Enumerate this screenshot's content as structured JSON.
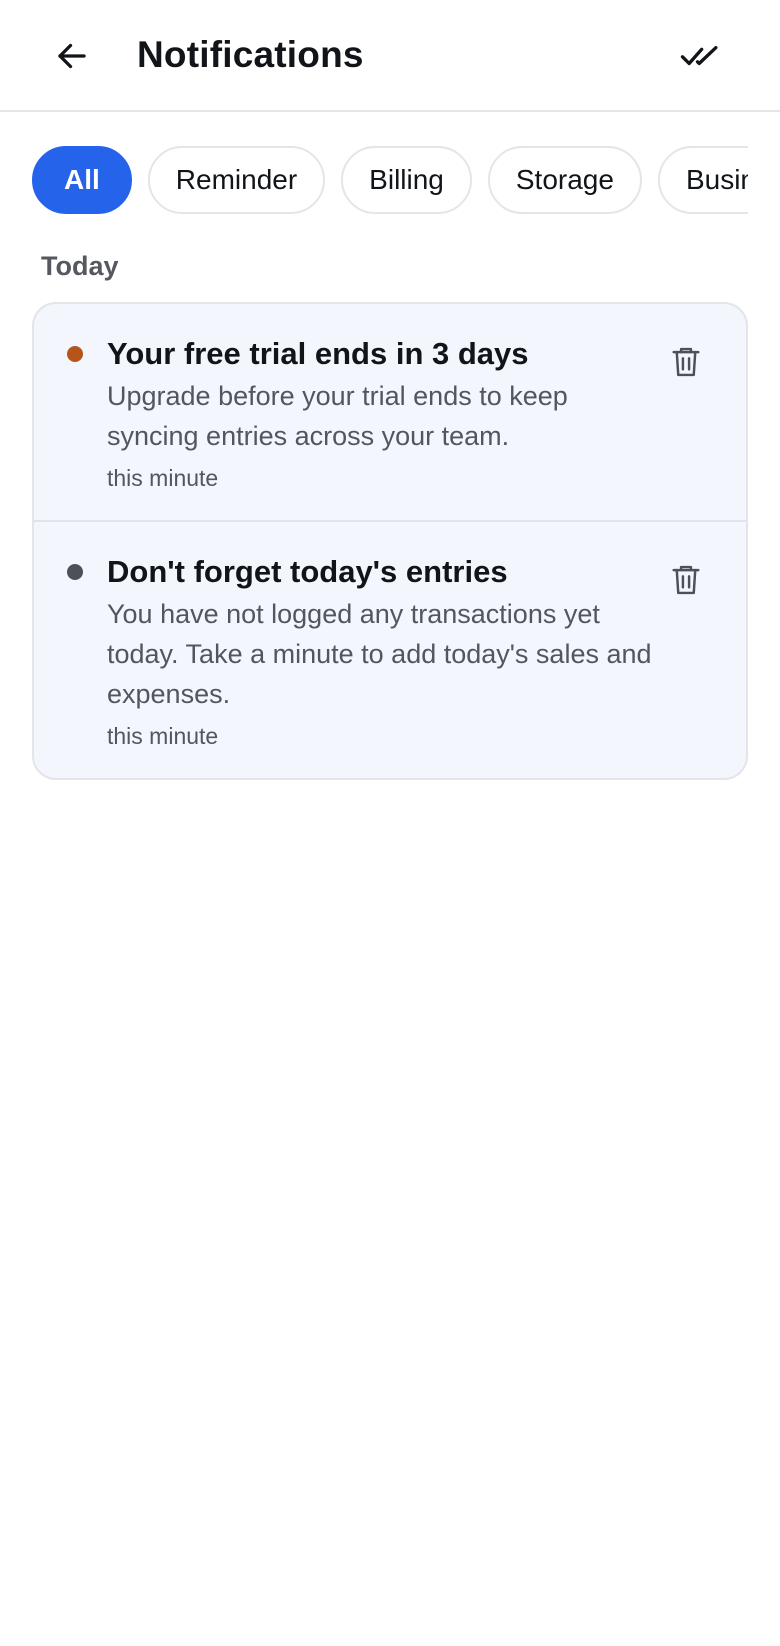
{
  "header": {
    "title": "Notifications",
    "back_icon": "arrow-left-icon",
    "mark_all_read_icon": "double-check-icon"
  },
  "filters": [
    {
      "label": "All",
      "active": true
    },
    {
      "label": "Reminder",
      "active": false
    },
    {
      "label": "Billing",
      "active": false
    },
    {
      "label": "Storage",
      "active": false
    },
    {
      "label": "Business",
      "active": false
    }
  ],
  "sections": [
    {
      "label": "Today",
      "notifications": [
        {
          "title": "Your free trial ends in 3 days",
          "body": "Upgrade before your trial ends to keep syncing entries across your team.",
          "time": "this minute",
          "dot_color": "#b5541b",
          "delete_icon": "trash-icon"
        },
        {
          "title": "Don't forget today's entries",
          "body": "You have not logged any transactions yet today. Take a minute to add today's sales and expenses.",
          "time": "this minute",
          "dot_color": "#4b5059",
          "delete_icon": "trash-icon"
        }
      ]
    }
  ],
  "colors": {
    "accent": "#2563eb",
    "card_background": "#f3f6fd",
    "border": "#e3e5e8"
  }
}
